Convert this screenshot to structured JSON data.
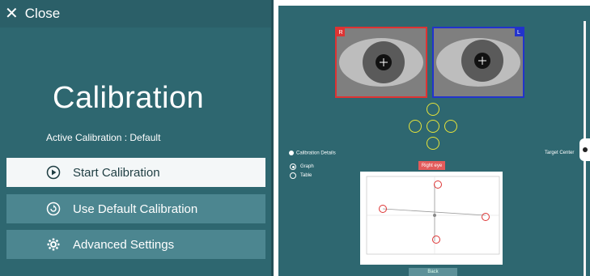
{
  "left_panel": {
    "close_label": "Close",
    "title": "Calibration",
    "subtitle": "Active Calibration : Default",
    "buttons": [
      {
        "label": "Start Calibration",
        "icon": "play-circle-icon"
      },
      {
        "label": "Use Default Calibration",
        "icon": "reset-icon"
      },
      {
        "label": "Advanced Settings",
        "icon": "gear-icon"
      }
    ]
  },
  "right_panel": {
    "eyes": {
      "right_tag": "R",
      "left_tag": "L"
    },
    "calibration_details_label": "Calibration Details",
    "view_options": [
      {
        "label": "Graph",
        "selected": true
      },
      {
        "label": "Table",
        "selected": false
      }
    ],
    "target_center_label": "Target Center",
    "right_eye_label": "Right eye",
    "bottom_button_label": "Back"
  },
  "colors": {
    "panel": "#2e6770",
    "primary_button": "#f4f7f8",
    "secondary_button": "#4c8690",
    "target_ring": "#e6e43a",
    "right_eye_border": "#d33333",
    "left_eye_border": "#2233cc"
  }
}
